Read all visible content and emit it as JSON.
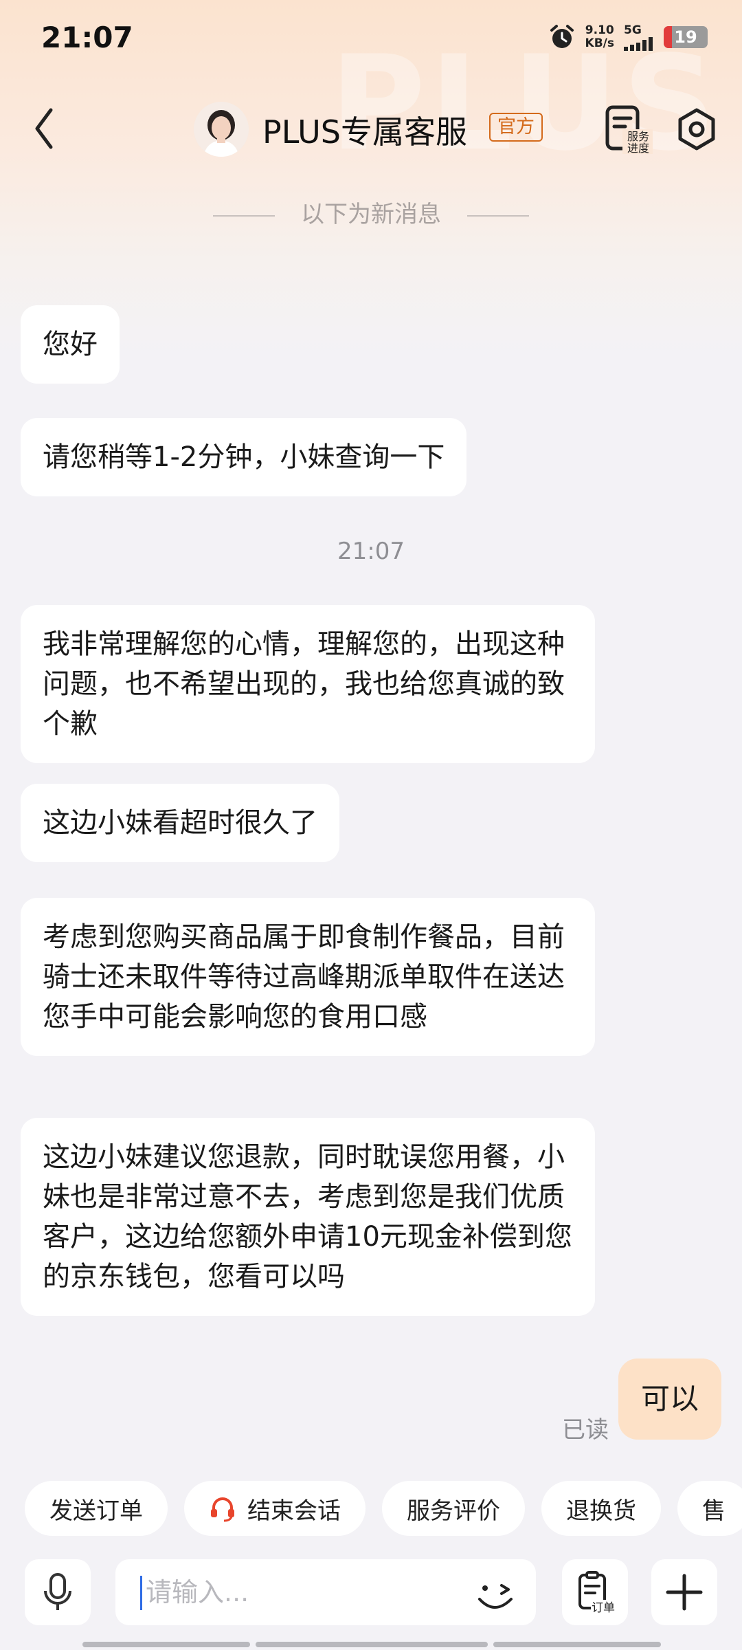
{
  "status_bar": {
    "time": "21:07",
    "net_speed_value": "9.10",
    "net_speed_unit": "KB/s",
    "network": "5G",
    "battery": "19"
  },
  "header": {
    "watermark": "PLUS",
    "title": "PLUS专属客服",
    "badge": "官方",
    "progress_label_1": "服务",
    "progress_label_2": "进度"
  },
  "divider_text": "以下为新消息",
  "messages": [
    {
      "text": "您好"
    },
    {
      "text": "请您稍等1-2分钟，小妹查询一下"
    },
    {
      "text": "我非常理解您的心情，理解您的，出现这种问题，也不希望出现的，我也给您真诚的致个歉"
    },
    {
      "text": "这边小妹看超时很久了"
    },
    {
      "text": "考虑到您购买商品属于即食制作餐品，目前骑士还未取件等待过高峰期派单取件在送达您手中可能会影响您的食用口感"
    },
    {
      "text": "这边小妹建议您退款，同时耽误您用餐，小妹也是非常过意不去，考虑到您是我们优质客户，这边给您额外申请10元现金补偿到您的京东钱包，您看可以吗"
    }
  ],
  "timestamp": "21:07",
  "my_message": {
    "text": "可以",
    "status": "已读"
  },
  "quick_actions": [
    "发送订单",
    "结束会话",
    "服务评价",
    "退换货",
    "售"
  ],
  "input": {
    "placeholder": "请输入...",
    "order_label": "订单"
  },
  "colors": {
    "accent": "#d46a1b",
    "my_bubble": "#fde1c7",
    "end_chat_icon": "#e8452c"
  }
}
